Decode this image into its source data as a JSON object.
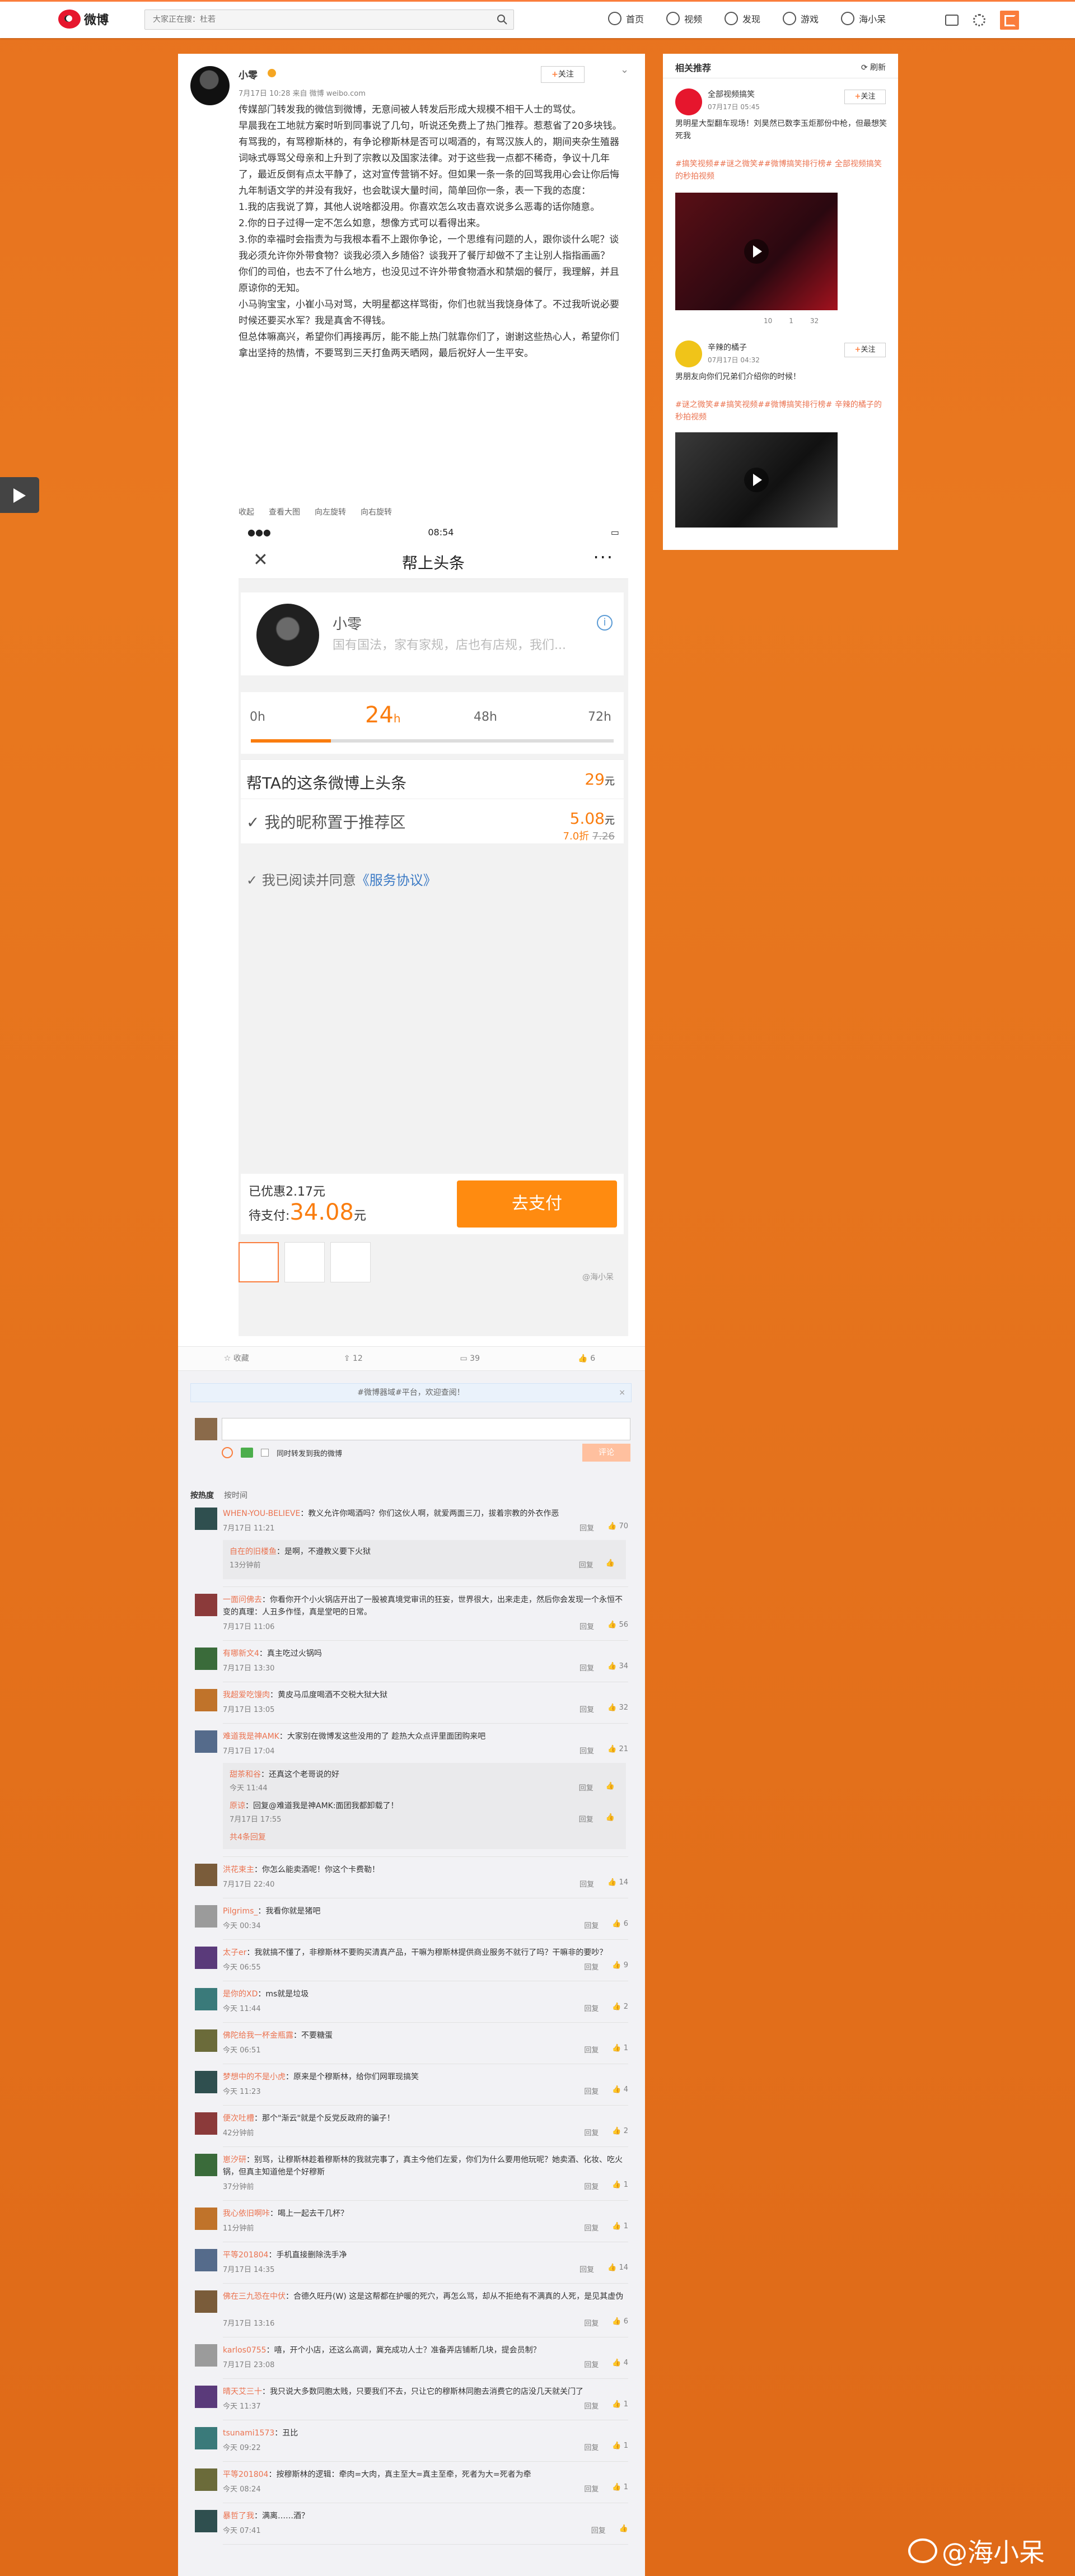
{
  "nav": {
    "logo": "微博",
    "search_placeholder": "大家正在搜：杜若",
    "items": [
      {
        "label": "首页",
        "icon": "home-icon"
      },
      {
        "label": "视频",
        "icon": "video-icon"
      },
      {
        "label": "发现",
        "icon": "compass-icon"
      },
      {
        "label": "游戏",
        "icon": "gamepad-icon"
      },
      {
        "label": "海小呆",
        "icon": "user-icon"
      }
    ]
  },
  "post": {
    "author": "小零",
    "meta": "7月17日 10:28 来自 微博 weibo.com",
    "follow": "关注",
    "paragraphs": [
      "传媒部门转发我的微信到微博，无意间被人转发后形成大规模不相干人士的骂仗。",
      "早晨我在工地就方案时听到同事说了几句，听说还免费上了热门推荐。惹惹省了20多块钱。",
      "有骂我的，有骂穆斯林的，有争论穆斯林是否可以喝酒的，有骂汉族人的，期间夹杂生殖器词咏式辱骂父母亲和上升到了宗教以及国家法律。对于这些我一点都不稀奇，争议十几年了，最近反倒有点太平静了，这对宣传营销不好。但如果一条一条的回骂我用心会让你后悔九年制语文学的并没有我好，也会耽误大量时间，简单回你一条，表一下我的态度：",
      "1.我的店我说了算，其他人说啥都没用。你喜欢怎么攻击喜欢说多么恶毒的话你随意。",
      "2.你的日子过得一定不怎么如意，想像方式可以看得出来。",
      "3.你的幸福时会指责为与我根本看不上跟你争论，一个思维有问题的人，跟你谈什么呢？谈我必须允许你外带食物？谈我必须入乡随俗？谈我开了餐厅却做不了主让别人指指画画？",
      "你们的司伯，也去不了什么地方，也没见过不许外带食物酒水和禁烟的餐厅，我理解，并且原谅你的无知。",
      "小马驹宝宝，小崔小马对骂，大明星都这样骂街，你们也就当我饶身体了。不过我听说必要时候还要买水军？我是真舍不得钱。",
      "但总体嘛高兴，希望你们再接再厉，能不能上热门就靠你们了，谢谢这些热心人，希望你们拿出坚持的热情，不要骂到三天打鱼两天晒网，最后祝好人一生平安。"
    ],
    "tools": [
      "收起",
      "查看大图",
      "向左旋转",
      "向右旋转"
    ]
  },
  "phone": {
    "time": "08:54",
    "title": "帮上头条",
    "name": "小零",
    "bio": "国有国法，家有家规，店也有店规，我们...",
    "timeline": [
      "0h",
      "24h",
      "48h",
      "72h"
    ],
    "active_label": "24",
    "active_unit": "h",
    "progress": 0.22,
    "row1_label": "帮TA的这条微博上头条",
    "row1_price": "29",
    "row2_label": "我的昵称置于推荐区",
    "row2_price": "5.08",
    "row2_sub": "7.0折",
    "row2_orig": "7.26",
    "yuan": "元",
    "agree_text": "我已阅读并同意",
    "agree_link": "《服务协议》",
    "discount": "已优惠2.17元",
    "due_label": "待支付:",
    "due_amount": "34.08",
    "pay_button": "去支付"
  },
  "watermark_small": "@海小呆",
  "actions": {
    "fav": "收藏",
    "repost": "12",
    "comment": "39",
    "like": "6"
  },
  "comments_area": {
    "notice": "#微博器域#平台，欢迎查阅！",
    "sync_label": "同时转发到我的微博",
    "submit": "评论",
    "sort_hot": "按热度",
    "sort_time": "按时间",
    "reply": "回复",
    "list": [
      {
        "nick": "WHEN-YOU-BELIEVE",
        "text": "：教义允许你喝酒吗？你们这伙人啊，就爱两面三刀，拔着宗教的外衣作恶",
        "time": "7月17日 11:21",
        "likes": "70",
        "replies": [
          {
            "nick": "自在的旧楼鱼",
            "text": "：是啊，不遵教义要下火狱",
            "time": "13分钟前"
          }
        ]
      },
      {
        "nick": "一面问佛去",
        "text": "：你看你开个小火锅店开出了一股被真境党审讯的狂妄，世界很大，出来走走，然后你会发现一个永恒不变的真理：人丑多作怪，真是堂吧的日常。",
        "time": "7月17日 11:06",
        "likes": "56",
        "replies": []
      },
      {
        "nick": "有哪新文4",
        "text": "：真主吃过火锅吗",
        "time": "7月17日 13:30",
        "likes": "34",
        "replies": []
      },
      {
        "nick": "我超爱吃馒肉",
        "text": "：黄皮马瓜度喝酒不交税大狱大狱",
        "time": "7月17日 13:05",
        "likes": "32",
        "replies": []
      },
      {
        "nick": "难道我是神AMK",
        "text": "：大家别在微博发这些没用的了 趁热大众点评里面团购来吧",
        "time": "7月17日 17:04",
        "likes": "21",
        "replies": [
          {
            "nick": "甜茶和谷",
            "text": "：还真这个老哥说的好",
            "time": "今天 11:44"
          },
          {
            "nick": "原谅",
            "text": "：回复@难道我是神AMK:面团我都卸载了！",
            "time": "7月17日 17:55"
          }
        ],
        "more": "共4条回复"
      },
      {
        "nick": "洪花束主",
        "text": "：你怎么能卖酒呢！你这个卡费勒！",
        "time": "7月17日 22:40",
        "likes": "14",
        "replies": []
      },
      {
        "nick": "Pilgrims_",
        "text": "：我看你就是猪吧",
        "time": "今天 00:34",
        "likes": "6",
        "replies": []
      },
      {
        "nick": "太子er",
        "text": "：我就搞不懂了，非穆斯林不要购买清真产品，干嘛为穆斯林提供商业服务不就行了吗？干嘛非的要吵？",
        "time": "今天 06:55",
        "likes": "9",
        "replies": []
      },
      {
        "nick": "是你的XD",
        "text": "：ms就是垃圾",
        "time": "今天 11:44",
        "likes": "2",
        "replies": []
      },
      {
        "nick": "佛陀给我一杯金瓶露",
        "text": "：不要糖蛋",
        "time": "今天 06:51",
        "likes": "1",
        "replies": []
      },
      {
        "nick": "梦想中的不是小虎",
        "text": "：原来是个穆斯林，给你们网罪现搞笑",
        "time": "今天 11:23",
        "likes": "4",
        "replies": []
      },
      {
        "nick": "便次吐槽",
        "text": "：那个\"渐云\"就是个反党反政府的骗子！",
        "time": "42分钟前",
        "likes": "2",
        "replies": []
      },
      {
        "nick": "崽汐研",
        "text": "：别骂，让穆斯林趁着穆斯林的我就完事了，真主今他们左爱，你们为什么要用他玩呢？她卖酒、化妆、吃火锅，但真主知道他是个好穆斯",
        "time": "37分钟前",
        "likes": "1",
        "replies": []
      },
      {
        "nick": "我心依旧啊咔",
        "text": "：喝上一起去干几杯？",
        "time": "11分钟前",
        "likes": "1",
        "replies": []
      },
      {
        "nick": "平等201804",
        "text": "：手机直接删除洗手净",
        "time": "7月17日 14:35",
        "likes": "14",
        "replies": []
      },
      {
        "nick": "佛在三九恐在中伏",
        "text": "：合德久旺丹(W) 这是这帮都在护暖的死穴，再怎么骂，却从不拒绝有不满真的人死，是见其虚伪",
        "time": "7月17日 13:16",
        "likes": "6",
        "replies": []
      },
      {
        "nick": "karlos0755",
        "text": "：嘻，开个小店，还这么高调，冀充成功人士？准备弄店铺断几块，提会员制？",
        "time": "7月17日 23:08",
        "likes": "4",
        "replies": []
      },
      {
        "nick": "晴天艾三十",
        "text": "：我只说大多数同胞太贱，只要我们不去，只让它的穆斯林同胞去消费它的店没几天就关门了",
        "time": "今天 11:37",
        "likes": "1",
        "replies": []
      },
      {
        "nick": "tsunami1573",
        "text": "：丑比",
        "time": "今天 09:22",
        "likes": "1",
        "replies": []
      },
      {
        "nick": "平等201804",
        "text": "：按穆斯林的逻辑：牵肉=大肉，真主至大=真主至牵，死者为大=死者为牵",
        "time": "今天 08:24",
        "likes": "1",
        "replies": []
      },
      {
        "nick": "暴哲了我",
        "text": "：满离……酒？",
        "time": "今天 07:41",
        "likes": "",
        "replies": []
      }
    ]
  },
  "sidebar": {
    "title": "相关推荐",
    "refresh": "刷新",
    "items": [
      {
        "name": "全部视频搞笑",
        "time": "07月17日 05:45",
        "follow": "关注",
        "text": "男明星大型翻车现场！刘昊然已数李玉炬那份中枪，但最想笑死我",
        "tags": "#搞笑视频##谜之微笑##微博搞笑排行榜# 全部视频搞笑的秒拍视频",
        "acts": [
          "10",
          "1",
          "32"
        ]
      },
      {
        "name": "辛辣的橘子",
        "time": "07月17日 04:32",
        "follow": "关注",
        "text": "男朋友向你们兄弟们介绍你的时候！",
        "tags": "#谜之微笑##搞笑视频##微博搞笑排行榜# 辛辣的橘子的秒拍视频",
        "acts": []
      }
    ]
  },
  "watermark_big": "@海小呆",
  "colors": {
    "accent": "#fa7d3c",
    "link": "#eb7350",
    "price": "#fa7d0f"
  }
}
